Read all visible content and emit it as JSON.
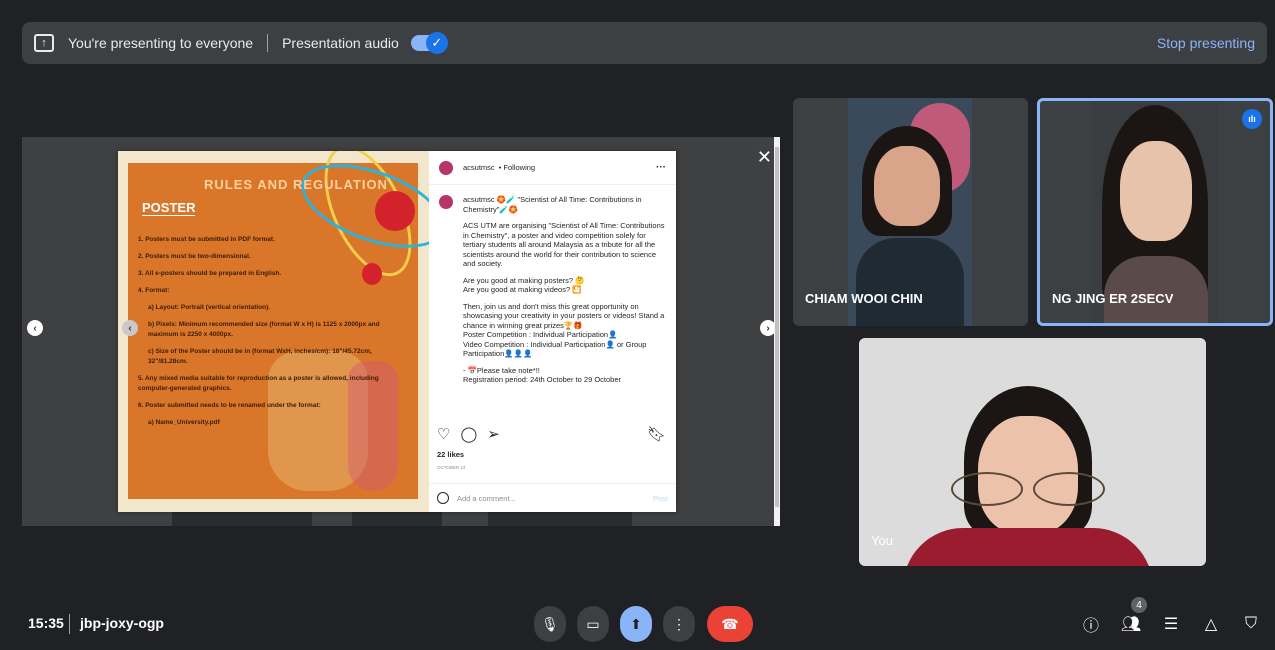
{
  "topbar": {
    "presenting_text": "You're presenting to everyone",
    "audio_label": "Presentation audio",
    "stop_label": "Stop presenting"
  },
  "screen": {
    "poster": {
      "heading": "RULES AND REGULATION",
      "subheading": "POSTER",
      "rules": [
        "1. Posters must be submitted in PDF format.",
        "2. Posters must be two-dimensional.",
        "3. All e-posters should be prepared in English.",
        "4. Format:",
        "a) Layout: Portrait (vertical orientation).",
        "b) Pixels: Minimum recommended size (format W x H) is 1125 x 2000px and maximum is 2250 x 4000px.",
        "c) Size of the Poster should be in (format WxH, inches/cm): 18\"/45.72cm, 32\"/81.28cm.",
        "5. Any mixed media suitable for reproduction as a poster is allowed, including computer-generated graphics.",
        "6. Poster submitted needs to be renamed under the format:",
        "a) Name_University.pdf"
      ]
    },
    "instagram": {
      "account": "acsutmsc",
      "follow_status": "• Following",
      "caption_title": "acsutmsc 🏵️🧪 \"Scientist of All Time: Contributions in Chemistry\"🧪🏵️",
      "paragraphs": [
        "ACS UTM are organising \"Scientist of All Time: Contributions in Chemistry\", a poster and video competition solely for tertiary students all around Malaysia as a tribute for all the scientists around the world for their contribution to science and society.",
        "Are you good at making posters? 🤔\nAre you good at making videos? 🎦",
        "Then, join us and don't miss this great opportunity on showcasing your creativity in your posters or videos! Stand a chance in winning great prizes🏆🎁\nPoster Competition : Individual Participation👤\nVideo Competition : Individual Participation👤 or Group Participation👤👤👤",
        "- 📅Please take note*!!\nRegistration period: 24th October to 29 October"
      ],
      "likes": "22 likes",
      "date": "OCTOBER 24",
      "comment_placeholder": "Add a comment...",
      "post_label": "Post"
    }
  },
  "participants": [
    {
      "name": "CHIAM WOOI CHIN"
    },
    {
      "name": "NG JING ER 2SECV"
    },
    {
      "name": "You"
    }
  ],
  "bottom": {
    "time": "15:35",
    "meeting_code": "jbp-joxy-ogp",
    "people_count": "4"
  },
  "colors": {
    "background": "#202124",
    "accent": "#8ab4f8",
    "end_call": "#ea4335",
    "speaking": "#1a73e8"
  }
}
